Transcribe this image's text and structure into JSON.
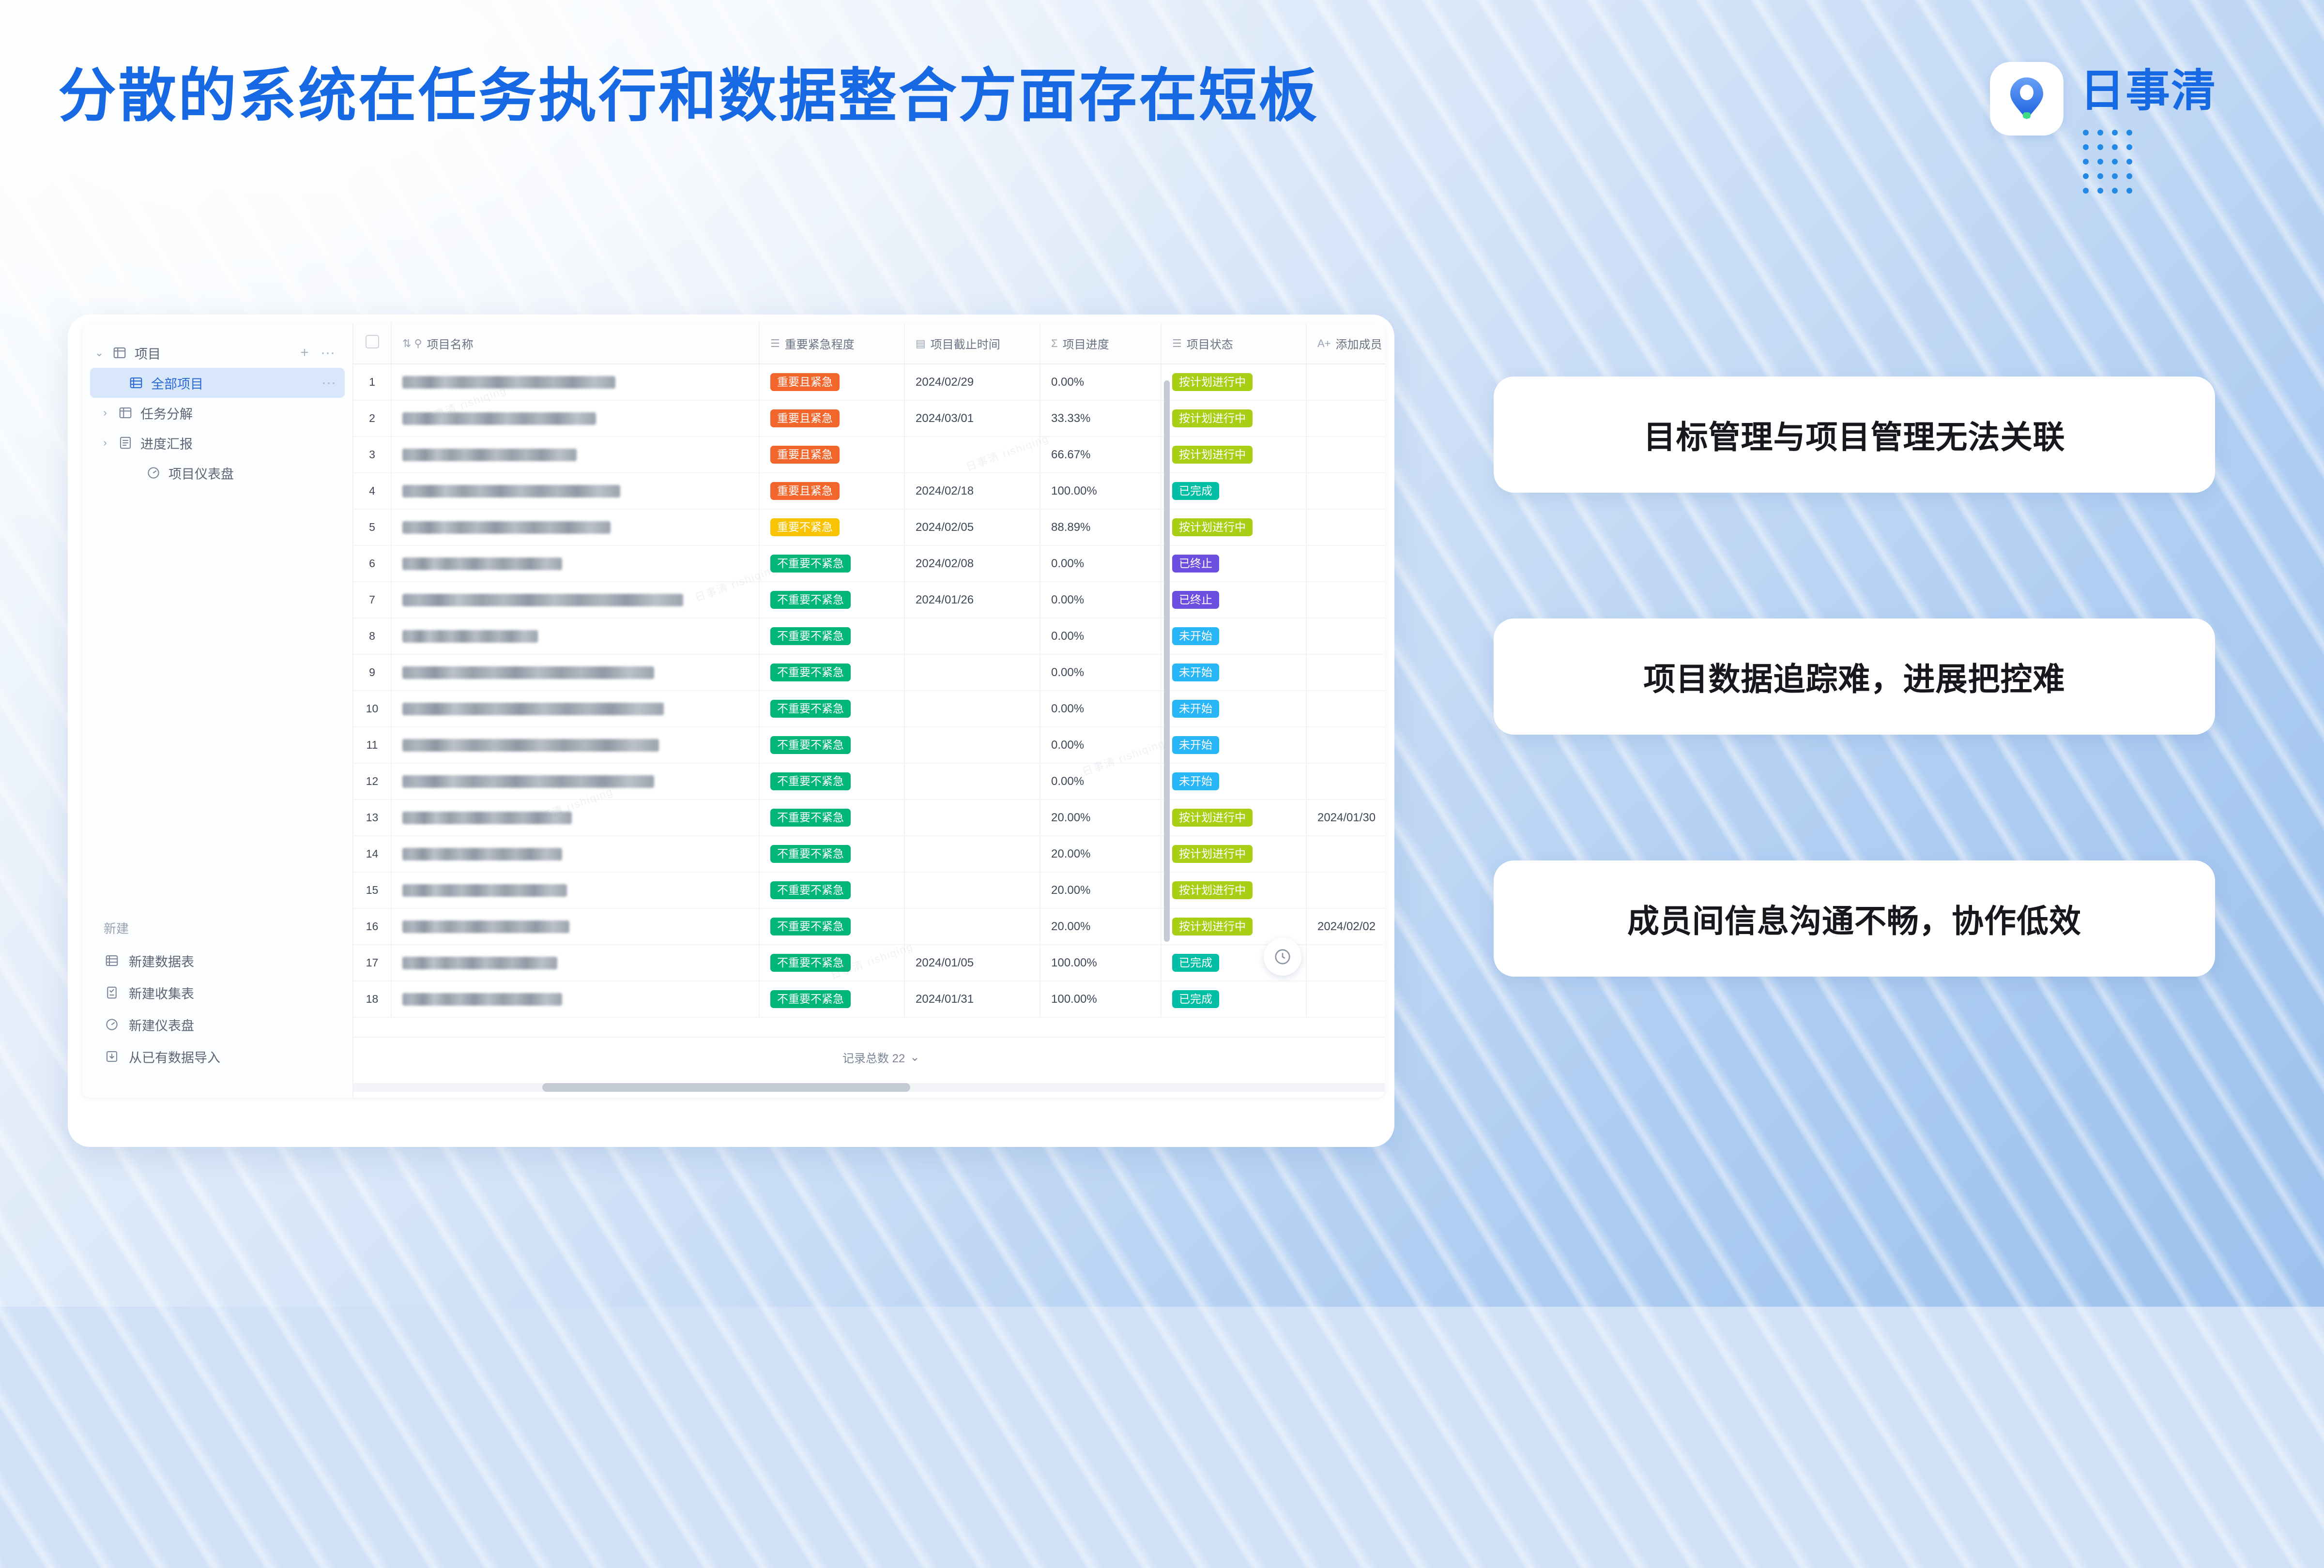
{
  "slide": {
    "title": "分散的系统在任务执行和数据整合方面存在短板"
  },
  "brand": {
    "name": "日事清",
    "logo_icon": "location-pin-icon"
  },
  "app": {
    "sidebar": {
      "group": {
        "label": "项目",
        "icon": "board-icon",
        "add_label": "+",
        "more_label": "···",
        "caret": "⌄"
      },
      "items": [
        {
          "label": "全部项目",
          "icon": "table-icon",
          "selected": true,
          "caret": "",
          "more": "···"
        },
        {
          "label": "任务分解",
          "icon": "board-icon",
          "selected": false,
          "caret": "›",
          "more": ""
        },
        {
          "label": "进度汇报",
          "icon": "report-icon",
          "selected": false,
          "caret": "›",
          "more": ""
        },
        {
          "label": "项目仪表盘",
          "icon": "dashboard-icon",
          "selected": false,
          "caret": "",
          "more": ""
        }
      ],
      "create": {
        "title": "新建",
        "items": [
          {
            "label": "新建数据表",
            "icon": "table-icon"
          },
          {
            "label": "新建收集表",
            "icon": "form-icon"
          },
          {
            "label": "新建仪表盘",
            "icon": "dashboard-icon"
          },
          {
            "label": "从已有数据导入",
            "icon": "import-icon"
          }
        ]
      }
    },
    "table": {
      "columns": [
        {
          "key": "chk",
          "label": "",
          "icon": "checkbox-icon",
          "cls": "col-chk"
        },
        {
          "key": "name",
          "label": "项目名称",
          "icon": "sort-lock-icon",
          "cls": "col-name"
        },
        {
          "key": "pri",
          "label": "重要紧急程度",
          "icon": "select-icon",
          "cls": "col-pri"
        },
        {
          "key": "due",
          "label": "项目截止时间",
          "icon": "calendar-icon",
          "cls": "col-due"
        },
        {
          "key": "prog",
          "label": "项目进度",
          "icon": "formula-icon",
          "cls": "col-prog"
        },
        {
          "key": "stat",
          "label": "项目状态",
          "icon": "select-icon",
          "cls": "col-stat"
        },
        {
          "key": "memb",
          "label": "添加成员",
          "icon": "person-icon",
          "cls": "col-memb"
        }
      ],
      "rows": [
        {
          "no": "1",
          "name_w": 440,
          "pri": "重要且紧急",
          "due": "2024/02/29",
          "prog": "0.00%",
          "stat": "按计划进行中",
          "memb": ""
        },
        {
          "no": "2",
          "name_w": 400,
          "pri": "重要且紧急",
          "due": "2024/03/01",
          "prog": "33.33%",
          "stat": "按计划进行中",
          "memb": ""
        },
        {
          "no": "3",
          "name_w": 360,
          "pri": "重要且紧急",
          "due": "",
          "prog": "66.67%",
          "stat": "按计划进行中",
          "memb": ""
        },
        {
          "no": "4",
          "name_w": 450,
          "pri": "重要且紧急",
          "due": "2024/02/18",
          "prog": "100.00%",
          "stat": "已完成",
          "memb": ""
        },
        {
          "no": "5",
          "name_w": 430,
          "pri": "重要不紧急",
          "due": "2024/02/05",
          "prog": "88.89%",
          "stat": "按计划进行中",
          "memb": ""
        },
        {
          "no": "6",
          "name_w": 330,
          "pri": "不重要不紧急",
          "due": "2024/02/08",
          "prog": "0.00%",
          "stat": "已终止",
          "memb": ""
        },
        {
          "no": "7",
          "name_w": 580,
          "pri": "不重要不紧急",
          "due": "2024/01/26",
          "prog": "0.00%",
          "stat": "已终止",
          "memb": ""
        },
        {
          "no": "8",
          "name_w": 280,
          "pri": "不重要不紧急",
          "due": "",
          "prog": "0.00%",
          "stat": "未开始",
          "memb": ""
        },
        {
          "no": "9",
          "name_w": 520,
          "pri": "不重要不紧急",
          "due": "",
          "prog": "0.00%",
          "stat": "未开始",
          "memb": ""
        },
        {
          "no": "10",
          "name_w": 540,
          "pri": "不重要不紧急",
          "due": "",
          "prog": "0.00%",
          "stat": "未开始",
          "memb": ""
        },
        {
          "no": "11",
          "name_w": 530,
          "pri": "不重要不紧急",
          "due": "",
          "prog": "0.00%",
          "stat": "未开始",
          "memb": ""
        },
        {
          "no": "12",
          "name_w": 520,
          "pri": "不重要不紧急",
          "due": "",
          "prog": "0.00%",
          "stat": "未开始",
          "memb": ""
        },
        {
          "no": "13",
          "name_w": 350,
          "pri": "不重要不紧急",
          "due": "",
          "prog": "20.00%",
          "stat": "按计划进行中",
          "memb": "2024/01/30"
        },
        {
          "no": "14",
          "name_w": 330,
          "pri": "不重要不紧急",
          "due": "",
          "prog": "20.00%",
          "stat": "按计划进行中",
          "memb": ""
        },
        {
          "no": "15",
          "name_w": 340,
          "pri": "不重要不紧急",
          "due": "",
          "prog": "20.00%",
          "stat": "按计划进行中",
          "memb": ""
        },
        {
          "no": "16",
          "name_w": 345,
          "pri": "不重要不紧急",
          "due": "",
          "prog": "20.00%",
          "stat": "按计划进行中",
          "memb": "2024/02/02"
        },
        {
          "no": "17",
          "name_w": 320,
          "pri": "不重要不紧急",
          "due": "2024/01/05",
          "prog": "100.00%",
          "stat": "已完成",
          "memb": ""
        },
        {
          "no": "18",
          "name_w": 330,
          "pri": "不重要不紧急",
          "due": "2024/01/31",
          "prog": "100.00%",
          "stat": "已完成",
          "memb": ""
        }
      ],
      "footer": {
        "count_label": "记录总数 22",
        "caret": "⌄"
      },
      "fab_icon": "clock-icon"
    },
    "colors": {
      "pri_urgent_important": "#f2662c",
      "pri_important_not_urgent": "#fac302",
      "pri_not_important_not_urgent": "#00b578",
      "stat_in_progress": "#a8cf16",
      "stat_done": "#00bfa5",
      "stat_stopped": "#6c4fe0",
      "stat_not_started": "#29b6f6",
      "brand_blue": "#1668e3",
      "selected_row": "#d9e7fb"
    }
  },
  "callouts": [
    {
      "text": "目标管理与项目管理无法关联"
    },
    {
      "text": "项目数据追踪难，进展把控难"
    },
    {
      "text": "成员间信息沟通不畅，协作低效"
    }
  ]
}
